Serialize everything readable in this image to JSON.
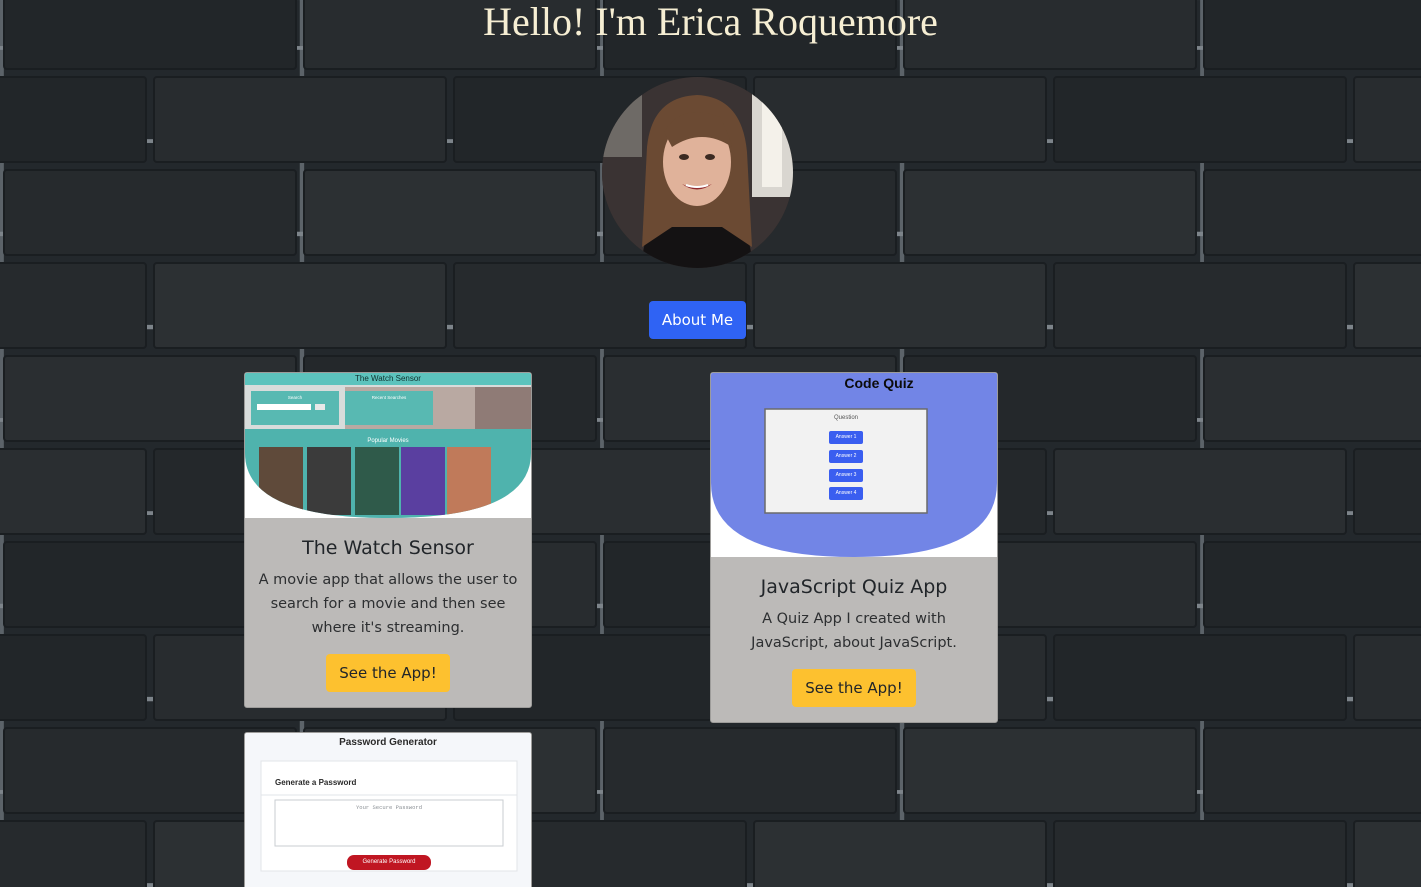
{
  "header": {
    "title": "Hello! I'm Erica Roquemore",
    "about_label": "About Me"
  },
  "colors": {
    "background": "#23282c",
    "mortar": "#7d848a",
    "title_text": "#f6eed3",
    "about_button": "#2f63f4",
    "app_button": "#fdc12f",
    "card_body": "#bcbab8"
  },
  "projects": [
    {
      "title": "The Watch Sensor",
      "description": "A movie app that allows the user to search for a movie and then see where it's streaming.",
      "button_label": "See the App!",
      "screenshot": {
        "heading": "The Watch Sensor",
        "search_label": "Search",
        "recent_label": "Recent Searches",
        "popular_label": "Popular Movies"
      }
    },
    {
      "title": "JavaScript Quiz App",
      "description": "A Quiz App I created with JavaScript, about JavaScript.",
      "button_label": "See the App!",
      "screenshot": {
        "heading": "Code Quiz",
        "question_label": "Question",
        "answers": [
          "Answer 1",
          "Answer 2",
          "Answer 3",
          "Answer 4"
        ]
      }
    },
    {
      "screenshot": {
        "heading": "Password Generator",
        "subheading": "Generate a Password",
        "placeholder": "Your Secure Password",
        "button_label": "Generate Password"
      }
    }
  ]
}
